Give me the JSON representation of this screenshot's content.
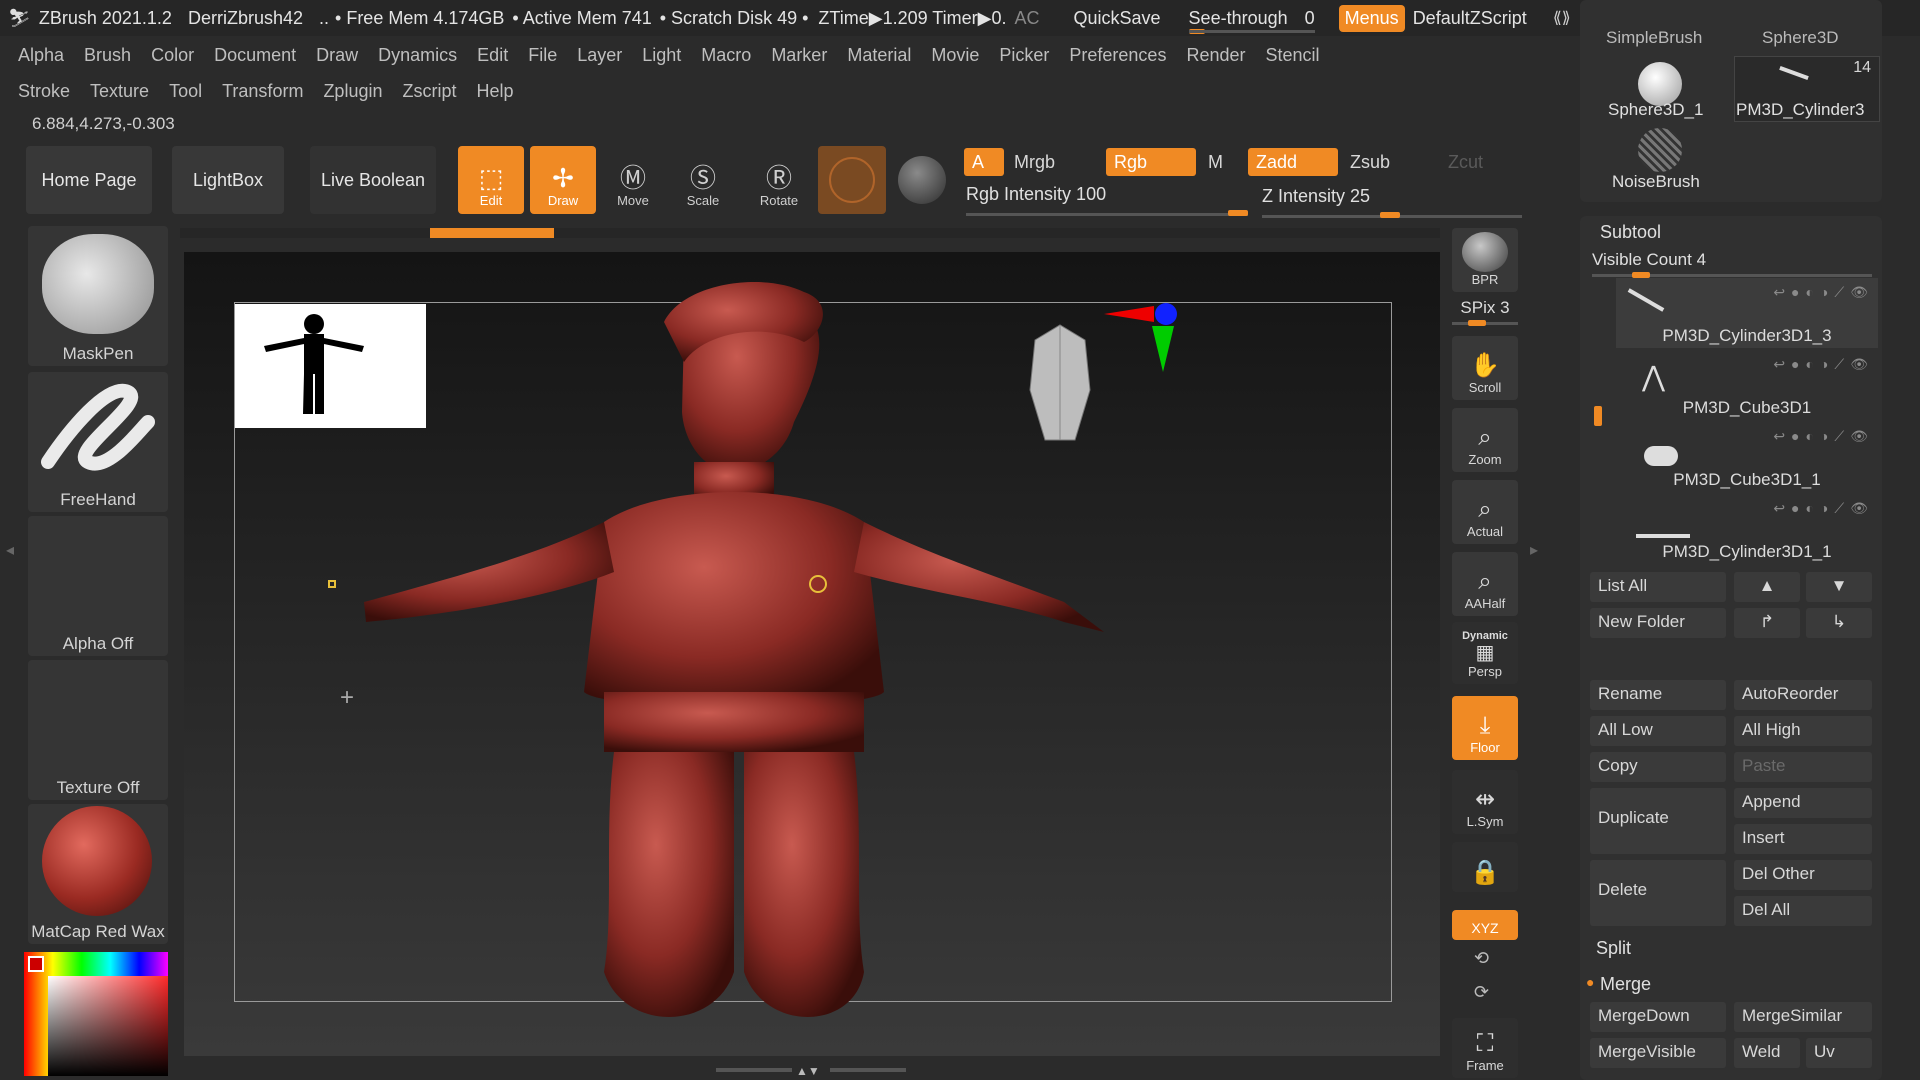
{
  "titlebar": {
    "app": "ZBrush 2021.1.2",
    "user": "DerriZbrush42",
    "free_mem": "• Free Mem 4.174GB",
    "active_mem": "• Active Mem 741",
    "scratch": "• Scratch Disk 49 •",
    "ztime": "ZTime▶1.209 Timer▶0.",
    "ac": "AC",
    "quicksave": "QuickSave",
    "seethrough_label": "See-through",
    "seethrough_value": "0",
    "menus": "Menus",
    "script": "DefaultZScript"
  },
  "menus_row1": [
    "Alpha",
    "Brush",
    "Color",
    "Document",
    "Draw",
    "Dynamics",
    "Edit",
    "File",
    "Layer",
    "Light",
    "Macro",
    "Marker",
    "Material",
    "Movie",
    "Picker",
    "Preferences",
    "Render",
    "Stencil"
  ],
  "menus_row2": [
    "Stroke",
    "Texture",
    "Tool",
    "Transform",
    "Zplugin",
    "Zscript",
    "Help"
  ],
  "coords": "6.884,4.273,-0.303",
  "toolbar": {
    "home": "Home Page",
    "lightbox": "LightBox",
    "liveboolean": "Live Boolean",
    "edit": "Edit",
    "draw": "Draw",
    "move": "Move",
    "scale": "Scale",
    "rotate": "Rotate",
    "a": "A",
    "mrgb": "Mrgb",
    "rgb": "Rgb",
    "m": "M",
    "zadd": "Zadd",
    "zsub": "Zsub",
    "zcut": "Zcut",
    "rgb_intensity": "Rgb Intensity 100",
    "z_intensity": "Z Intensity 25"
  },
  "left": {
    "maskpen": "MaskPen",
    "freehand": "FreeHand",
    "alpha": "Alpha Off",
    "texture": "Texture Off",
    "matcap": "MatCap Red Wax"
  },
  "shelf": {
    "bpr": "BPR",
    "spix": "SPix 3",
    "scroll": "Scroll",
    "zoom": "Zoom",
    "actual": "Actual",
    "aahalf": "AAHalf",
    "dynamic": "Dynamic",
    "persp": "Persp",
    "floor": "Floor",
    "lsym": "L.Sym",
    "xyz": "XYZ",
    "frame": "Frame"
  },
  "toolpanel": {
    "simplebrush": "SimpleBrush",
    "sphere3d": "Sphere3D",
    "sphere3d_1": "Sphere3D_1",
    "pm3d_cyl": "PM3D_Cylinder3",
    "count": "14",
    "noisebrush": "NoiseBrush"
  },
  "subtool": {
    "title": "Subtool",
    "visible_count": "Visible Count 4",
    "items": [
      "PM3D_Cylinder3D1_3",
      "PM3D_Cube3D1",
      "PM3D_Cube3D1_1",
      "PM3D_Cylinder3D1_1"
    ],
    "list_all": "List All",
    "new_folder": "New Folder",
    "rename": "Rename",
    "autoreorder": "AutoReorder",
    "all_low": "All Low",
    "all_high": "All High",
    "copy": "Copy",
    "paste": "Paste",
    "duplicate": "Duplicate",
    "append": "Append",
    "insert": "Insert",
    "delete": "Delete",
    "del_other": "Del Other",
    "del_all": "Del All",
    "split": "Split",
    "merge": "Merge",
    "mergedown": "MergeDown",
    "mergesimilar": "MergeSimilar",
    "mergevisible": "MergeVisible",
    "weld": "Weld",
    "uv": "Uv"
  }
}
